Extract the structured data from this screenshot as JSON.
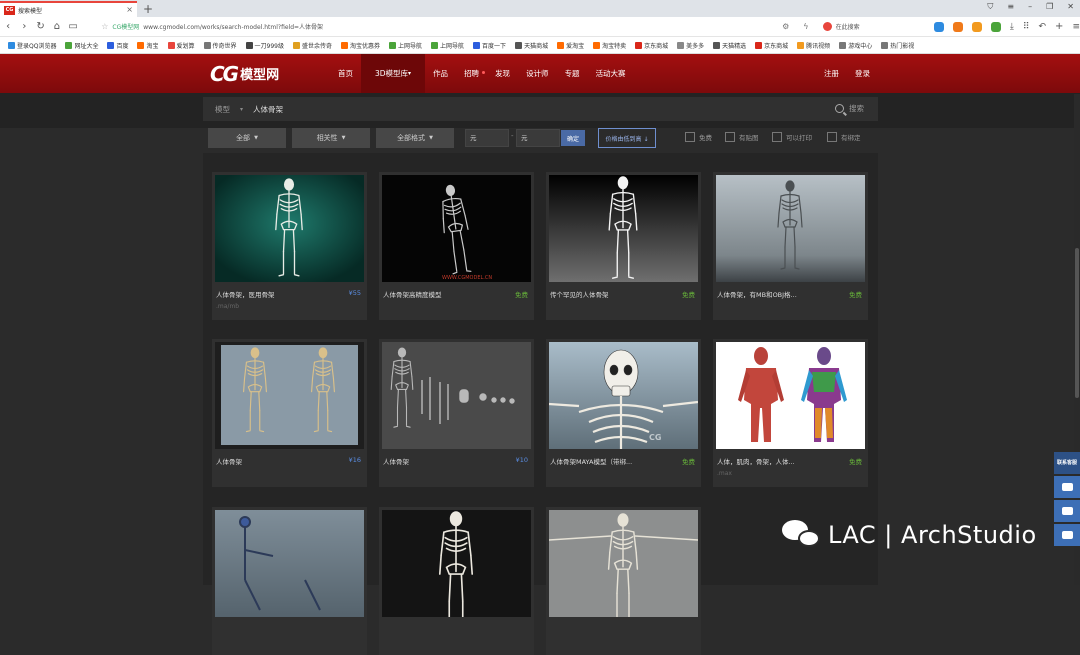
{
  "browser": {
    "tab_title": "搜索模型",
    "tab_icon_text": "CG",
    "url_site": "CG模型网",
    "url": "www.cgmodel.com/works/search-model.html?field=人体骨架",
    "search_placeholder": "在此搜索",
    "bookmarks": [
      {
        "label": "登录QQ浏览器",
        "color": "#2e8be0"
      },
      {
        "label": "网址大全",
        "color": "#4ba43a"
      },
      {
        "label": "百度",
        "color": "#2c5ede"
      },
      {
        "label": "淘宝",
        "color": "#ff6a00"
      },
      {
        "label": "爱划算",
        "color": "#e8453c"
      },
      {
        "label": "传奇世界",
        "color": "#777777"
      },
      {
        "label": "一刀999级",
        "color": "#444444"
      },
      {
        "label": "盛世余传奇",
        "color": "#e0a020"
      },
      {
        "label": "淘宝优惠券",
        "color": "#ff6a00"
      },
      {
        "label": "上网导航",
        "color": "#4ba43a"
      },
      {
        "label": "上网导航",
        "color": "#4ba43a"
      },
      {
        "label": "百度一下",
        "color": "#2c5ede"
      },
      {
        "label": "天猫商城",
        "color": "#555555"
      },
      {
        "label": "爱淘宝",
        "color": "#ff6a00"
      },
      {
        "label": "淘宝特卖",
        "color": "#ff6a00"
      },
      {
        "label": "京东商城",
        "color": "#d9271a"
      },
      {
        "label": "美多多",
        "color": "#888888"
      },
      {
        "label": "天猫精选",
        "color": "#555555"
      },
      {
        "label": "京东商城",
        "color": "#d9271a"
      },
      {
        "label": "腾讯视频",
        "color": "#f29a1f"
      },
      {
        "label": "游戏中心",
        "color": "#777777"
      },
      {
        "label": "热门影视",
        "color": "#777777"
      }
    ]
  },
  "site": {
    "logo_cg": "CG",
    "logo_text": "模型网",
    "nav": [
      {
        "label": "首页",
        "active": false
      },
      {
        "label": "3D模型库",
        "active": true
      },
      {
        "label": "作品",
        "active": false
      },
      {
        "label": "招聘",
        "active": false
      },
      {
        "label": "发现",
        "active": false
      },
      {
        "label": "设计师",
        "active": false
      },
      {
        "label": "专题",
        "active": false
      },
      {
        "label": "活动大赛",
        "active": false
      }
    ],
    "login": "注册",
    "register": "登录"
  },
  "breadcrumb": {
    "root": "模型",
    "current": "人体骨架",
    "search_label": "搜索"
  },
  "filters": {
    "category": "全部",
    "relevance": "相关性",
    "format": "全部格式",
    "price_from": "元",
    "price_to": "元",
    "confirm": "确定",
    "sort": "价格由低到高 ↓",
    "checks": [
      "免费",
      "有贴图",
      "可以打印",
      "有绑定"
    ]
  },
  "cards": [
    {
      "name": "人体骨架，医用骨架",
      "price": "¥55",
      "paid": true,
      "format": ".ma/mb",
      "thumb": "teal"
    },
    {
      "name": "人体骨架高精度模型",
      "price": "免费",
      "paid": false,
      "format": "",
      "thumb": "black"
    },
    {
      "name": "传个罕见的人体骨架",
      "price": "免费",
      "paid": false,
      "format": "",
      "thumb": "blackgrad"
    },
    {
      "name": "人体骨架，有MB和OBJ格...",
      "price": "免费",
      "paid": false,
      "format": "",
      "thumb": "greysky"
    },
    {
      "name": "人体骨架",
      "price": "¥16",
      "paid": true,
      "format": "",
      "thumb": "pair"
    },
    {
      "name": "人体骨架",
      "price": "¥10",
      "paid": true,
      "format": "",
      "thumb": "parts"
    },
    {
      "name": "人体骨架MAYA模型（带绑...",
      "price": "免费",
      "paid": false,
      "format": "",
      "thumb": "maya"
    },
    {
      "name": "人体，肌肉，骨架，人体...",
      "price": "免费",
      "paid": false,
      "format": ".max",
      "thumb": "muscle"
    },
    {
      "name": "",
      "price": "",
      "paid": false,
      "format": "",
      "thumb": "rig"
    },
    {
      "name": "",
      "price": "",
      "paid": false,
      "format": "",
      "thumb": "white"
    },
    {
      "name": "",
      "price": "",
      "paid": false,
      "format": "",
      "thumb": "grey"
    }
  ],
  "side_float": {
    "label": "联系客服"
  },
  "watermark": "LAC | ArchStudio"
}
